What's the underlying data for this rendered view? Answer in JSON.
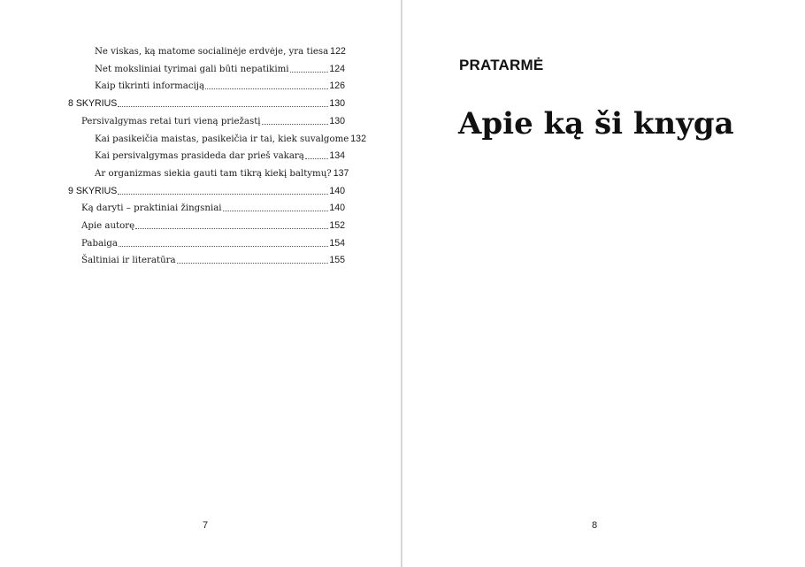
{
  "left_page": {
    "toc": [
      {
        "title": "Ne viskas, ką matome socialinėje erdvėje, yra tiesa",
        "page": "122",
        "level": 3
      },
      {
        "title": "Net moksliniai tyrimai gali būti nepatikimi",
        "page": "124",
        "level": 3
      },
      {
        "title": "Kaip tikrinti informaciją",
        "page": "126",
        "level": 3
      },
      {
        "title": "8 SKYRIUS",
        "page": "130",
        "level": 1
      },
      {
        "title": "Persivalgymas retai turi vieną priežastį",
        "page": "130",
        "level": 2
      },
      {
        "title": "Kai pasikeičia maistas, pasikeičia ir tai, kiek suvalgome",
        "page": "132",
        "level": 3
      },
      {
        "title": "Kai persivalgymas prasideda dar prieš vakarą",
        "page": "134",
        "level": 3
      },
      {
        "title": "Ar organizmas siekia gauti tam tikrą kiekį baltymų?",
        "page": "137",
        "level": 3
      },
      {
        "title": "9 SKYRIUS",
        "page": "140",
        "level": 1
      },
      {
        "title": "Ką daryti – praktiniai žingsniai",
        "page": "140",
        "level": 2
      },
      {
        "title": "Apie autorę",
        "page": "152",
        "level": 2
      },
      {
        "title": "Pabaiga",
        "page": "154",
        "level": 2
      },
      {
        "title": "Šaltiniai ir literatūra",
        "page": "155",
        "level": 2
      }
    ],
    "page_number": "7"
  },
  "right_page": {
    "kicker": "PRATARMĖ",
    "title": "Apie ką ši knyga",
    "page_number": "8"
  }
}
